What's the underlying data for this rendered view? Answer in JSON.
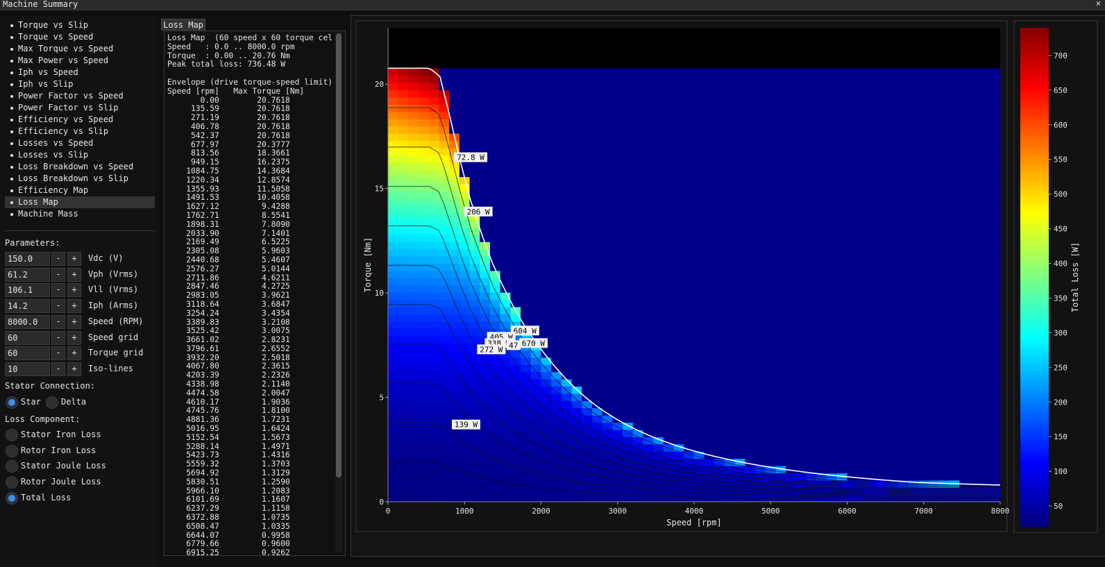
{
  "window": {
    "title": "Machine Summary",
    "close_icon": "×"
  },
  "nav": {
    "items": [
      "Torque vs Slip",
      "Torque vs Speed",
      "Max Torque vs Speed",
      "Max Power vs Speed",
      "Iph vs Speed",
      "Iph vs Slip",
      "Power Factor vs Speed",
      "Power Factor vs Slip",
      "Efficiency vs Speed",
      "Efficiency vs Slip",
      "Losses vs Speed",
      "Losses vs Slip",
      "Loss Breakdown vs Speed",
      "Loss Breakdown vs Slip",
      "Efficiency Map",
      "Loss Map",
      "Machine Mass"
    ],
    "selected": "Loss Map"
  },
  "parameters": {
    "heading": "Parameters:",
    "items": [
      {
        "value": "150.0",
        "label": "Vdc (V)"
      },
      {
        "value": "61.2",
        "label": "Vph (Vrms)"
      },
      {
        "value": "106.1",
        "label": "Vll (Vrms)"
      },
      {
        "value": "14.2",
        "label": "Iph (Arms)"
      },
      {
        "value": "8000.0",
        "label": "Speed (RPM)"
      },
      {
        "value": "60",
        "label": "Speed grid"
      },
      {
        "value": "60",
        "label": "Torque grid"
      },
      {
        "value": "10",
        "label": "Iso-lines"
      }
    ],
    "minus": "-",
    "plus": "+"
  },
  "stator_connection": {
    "heading": "Stator Connection:",
    "options": [
      "Star",
      "Delta"
    ],
    "selected": "Star"
  },
  "loss_component": {
    "heading": "Loss Component:",
    "options": [
      "Stator Iron Loss",
      "Rotor Iron Loss",
      "Stator Joule Loss",
      "Rotor Joule Loss",
      "Total Loss"
    ],
    "selected": "Total Loss"
  },
  "text_panel": {
    "tab": "Loss Map",
    "header": [
      "Loss Map  (60 speed x 60 torque cel",
      "Speed   : 0.0 .. 8000.0 rpm",
      "Torque  : 0.00 .. 20.76 Nm",
      "Peak total loss: 736.48 W",
      "",
      "Envelope (drive torque-speed limit)",
      "Speed [rpm]   Max Torque [Nm]"
    ],
    "rows": [
      [
        "0.00",
        "20.7618"
      ],
      [
        "135.59",
        "20.7618"
      ],
      [
        "271.19",
        "20.7618"
      ],
      [
        "406.78",
        "20.7618"
      ],
      [
        "542.37",
        "20.7618"
      ],
      [
        "677.97",
        "20.3777"
      ],
      [
        "813.56",
        "18.3661"
      ],
      [
        "949.15",
        "16.2375"
      ],
      [
        "1084.75",
        "14.3684"
      ],
      [
        "1220.34",
        "12.8574"
      ],
      [
        "1355.93",
        "11.5058"
      ],
      [
        "1491.53",
        "10.4058"
      ],
      [
        "1627.12",
        "9.4288"
      ],
      [
        "1762.71",
        "8.5541"
      ],
      [
        "1898.31",
        "7.8090"
      ],
      [
        "2033.90",
        "7.1401"
      ],
      [
        "2169.49",
        "6.5225"
      ],
      [
        "2305.08",
        "5.9603"
      ],
      [
        "2440.68",
        "5.4607"
      ],
      [
        "2576.27",
        "5.0144"
      ],
      [
        "2711.86",
        "4.6211"
      ],
      [
        "2847.46",
        "4.2725"
      ],
      [
        "2983.05",
        "3.9621"
      ],
      [
        "3118.64",
        "3.6847"
      ],
      [
        "3254.24",
        "3.4354"
      ],
      [
        "3389.83",
        "3.2108"
      ],
      [
        "3525.42",
        "3.0075"
      ],
      [
        "3661.02",
        "2.8231"
      ],
      [
        "3796.61",
        "2.6552"
      ],
      [
        "3932.20",
        "2.5018"
      ],
      [
        "4067.80",
        "2.3615"
      ],
      [
        "4203.39",
        "2.2326"
      ],
      [
        "4338.98",
        "2.1140"
      ],
      [
        "4474.58",
        "2.0047"
      ],
      [
        "4610.17",
        "1.9036"
      ],
      [
        "4745.76",
        "1.8100"
      ],
      [
        "4881.36",
        "1.7231"
      ],
      [
        "5016.95",
        "1.6424"
      ],
      [
        "5152.54",
        "1.5673"
      ],
      [
        "5288.14",
        "1.4971"
      ],
      [
        "5423.73",
        "1.4316"
      ],
      [
        "5559.32",
        "1.3703"
      ],
      [
        "5694.92",
        "1.3129"
      ],
      [
        "5830.51",
        "1.2590"
      ],
      [
        "5966.10",
        "1.2083"
      ],
      [
        "6101.69",
        "1.1607"
      ],
      [
        "6237.29",
        "1.1158"
      ],
      [
        "6372.88",
        "1.0735"
      ],
      [
        "6508.47",
        "1.0335"
      ],
      [
        "6644.07",
        "0.9958"
      ],
      [
        "6779.66",
        "0.9600"
      ],
      [
        "6915.25",
        "0.9262"
      ]
    ]
  },
  "chart_data": {
    "type": "heatmap",
    "xlabel": "Speed [rpm]",
    "ylabel": "Torque [Nm]",
    "colorbar_label": "Total Loss [W]",
    "xlim": [
      0,
      8000
    ],
    "ylim": [
      0,
      22.7
    ],
    "xticks": [
      0,
      1000,
      2000,
      3000,
      4000,
      5000,
      6000,
      7000,
      8000
    ],
    "yticks": [
      0,
      5,
      10,
      15,
      20
    ],
    "cbar_range": [
      20,
      740
    ],
    "cbar_ticks": [
      50,
      100,
      150,
      200,
      250,
      300,
      350,
      400,
      450,
      500,
      550,
      600,
      650,
      700
    ],
    "colormap": "jet",
    "nan_region_color": "#000000",
    "contour_labels": [
      {
        "text": "72.8 W",
        "speed": 1080,
        "torque": 16.5
      },
      {
        "text": "206 W",
        "speed": 1180,
        "torque": 13.9
      },
      {
        "text": "604 W",
        "speed": 1790,
        "torque": 8.2
      },
      {
        "text": "405 W",
        "speed": 1480,
        "torque": 7.9
      },
      {
        "text": "338 W",
        "speed": 1450,
        "torque": 7.6
      },
      {
        "text": "47",
        "speed": 1640,
        "torque": 7.5
      },
      {
        "text": "670 W",
        "speed": 1900,
        "torque": 7.6
      },
      {
        "text": "272 W",
        "speed": 1350,
        "torque": 7.3
      },
      {
        "text": "139 W",
        "speed": 1020,
        "torque": 3.7
      }
    ]
  }
}
